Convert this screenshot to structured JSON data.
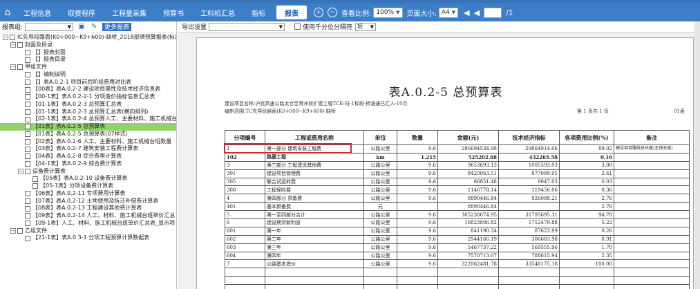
{
  "menu": {
    "home_icon": "house-icon",
    "tabs": [
      {
        "label": "工程信息"
      },
      {
        "label": "取费程序"
      },
      {
        "label": "工程量采集"
      },
      {
        "label": "预算书"
      },
      {
        "label": "工料机汇总"
      },
      {
        "label": "指标"
      },
      {
        "label": "报表"
      }
    ],
    "zoom_label": "查看比例:",
    "zoom_value": "100%",
    "pagesize_label": "页面大小:",
    "pagesize_value": "A4",
    "page_prev": "◀",
    "page_first": "◀",
    "page_next": "▶",
    "page_total": "/1"
  },
  "left": {
    "group_label": "报表组:",
    "more_btn": "更多报表",
    "tree": [
      {
        "level": 0,
        "tg": "⊟",
        "text": "IC先导段路面(K0+000~K9+600)-缺桥_2018部颁预算报表(标准"
      },
      {
        "level": 1,
        "tg": "⊟",
        "text": "封面及目录"
      },
      {
        "level": 2,
        "tg": "",
        "text": "【】报表封面"
      },
      {
        "level": 2,
        "tg": "",
        "text": "【】报表目录"
      },
      {
        "level": 1,
        "tg": "⊟",
        "text": "甲组文件"
      },
      {
        "level": 2,
        "tg": "",
        "text": "【】编制说明"
      },
      {
        "level": 2,
        "tg": "",
        "text": "【】表A.0.2-1 项目前后阶段费用对比表"
      },
      {
        "level": 2,
        "tg": "",
        "text": "【00表】表A.0.2-2 建设项目属性及技术经济信息表"
      },
      {
        "level": 2,
        "tg": "",
        "text": "【00-1表】表A.0.2-2-1 分项造价指标信息汇总表"
      },
      {
        "level": 2,
        "tg": "",
        "text": "【01-1表】表A.0.2-3 总预算汇总表"
      },
      {
        "level": 2,
        "tg": "",
        "text": "【01-1表】表A.0.2-3 总预算汇总表(横向排列)"
      },
      {
        "level": 2,
        "tg": "",
        "text": "【02-1表】表A.0.2-4 总预算人工、主要材料、施工机械台"
      },
      {
        "level": 2,
        "tg": "",
        "text": "【01表】表A.0.2-5 总预算表",
        "selected": true
      },
      {
        "level": 2,
        "tg": "",
        "text": "【01表】表A.0.2-5 总预算表(07样式)"
      },
      {
        "level": 2,
        "tg": "",
        "text": "【02表】表A.0.2-6 人工、主要材料、施工机械台班数量"
      },
      {
        "level": 2,
        "tg": "",
        "text": "【03表】表A.0.2-7 建筑安装工程费计算表"
      },
      {
        "level": 2,
        "tg": "",
        "text": "【04表】表A.0.2-8 综合费率计算表"
      },
      {
        "level": 2,
        "tg": "",
        "text": "【04-1表】表A.0.2-9 综合费计算表"
      },
      {
        "level": 2,
        "tg": "⊟",
        "text": "设备费计算表"
      },
      {
        "level": 3,
        "tg": "",
        "text": "【05表】表A.0.2-10 设备费计算表"
      },
      {
        "level": 3,
        "tg": "",
        "text": "【05-1表】分项设备费计算表"
      },
      {
        "level": 2,
        "tg": "",
        "text": "【06表】表A.0.2-11 专项费用计算表"
      },
      {
        "level": 2,
        "tg": "",
        "text": "【07表】表A.0.2-12 土地使用及拆迁补偿费计算表"
      },
      {
        "level": 2,
        "tg": "",
        "text": "【08表】表A.0.2-13 工程建设其他费计算表"
      },
      {
        "level": 2,
        "tg": "",
        "text": "【09表】表A.0.2-14 人工、材料、施工机械台班单价汇总"
      },
      {
        "level": 2,
        "tg": "",
        "text": "【09-1表】人工、材料、施工机械台班单价汇总表_显示项"
      },
      {
        "level": 1,
        "tg": "⊟",
        "text": "乙组文件"
      },
      {
        "level": 2,
        "tg": "",
        "text": "【21-1表】表A.0.3-1 分项工程预算计算数据表"
      }
    ]
  },
  "right": {
    "export_label": "导出设置",
    "thousands_label": "使用千分位分隔符",
    "sel2_value": "项"
  },
  "report": {
    "title": "表A.0.2-5 总预算表",
    "project_line": "建设项目名称:沪武高速公路太仓至常州段扩建工程TCK-SJ-1标段-桥涵通已汇入-10月",
    "scope_line": "编制范围:TC先导段路面(K0+000~K9+600)-缺桥",
    "page_info": "第 1 页共 1 页",
    "form_no": "01表",
    "headers": [
      "分项编号",
      "工程或费用名称",
      "单位",
      "数量",
      "金额(元)",
      "技术经济指标",
      "各项费用比例(%)",
      "备注"
    ],
    "rows": [
      [
        "1",
        "第一部分 建筑安装工程费",
        "公路公里",
        "9.6",
        "286694534.98",
        "29864014.06",
        "89.02",
        "建设项目路线总长度(主线长度)"
      ],
      [
        "102",
        "路基工程",
        "km",
        "1.215",
        "525202.68",
        "432265.58",
        "0.16",
        ""
      ],
      [
        "3",
        "第三部分 工程建设其他费",
        "公路公里",
        "9.6",
        "9653693.13",
        "1005593.03",
        "3.00",
        ""
      ],
      [
        "301",
        "建设项目管理费",
        "公路公里",
        "9.6",
        "8420063.51",
        "877089.95",
        "2.61",
        ""
      ],
      [
        "305",
        "联合试运转费",
        "公路公里",
        "9.6",
        "86851.48",
        "9047.03",
        "0.03",
        ""
      ],
      [
        "308",
        "工程保险费",
        "公路公里",
        "9.6",
        "1146778.14",
        "119456.06",
        "0.36",
        ""
      ],
      [
        "4",
        "第四部分 预备费",
        "公路公里",
        "9.6",
        "8890446.84",
        "926088.21",
        "2.76",
        ""
      ],
      [
        "401",
        "基本预备费",
        "元",
        "",
        "8890446.84",
        "",
        "2.76",
        ""
      ],
      [
        "5",
        "第一至四部分合计",
        "公路公里",
        "9.6",
        "305238674.95",
        "31795695.31",
        "94.78",
        ""
      ],
      [
        "6",
        "建设期贷款利息",
        "公路公里",
        "9.6",
        "16823806.82",
        "1752479.88",
        "5.22",
        ""
      ],
      [
        "601",
        "第一年",
        "公路公里",
        "9.6",
        "841190.34",
        "87623.99",
        "0.26",
        ""
      ],
      [
        "602",
        "第二年",
        "公路公里",
        "9.6",
        "2944166.19",
        "306683.98",
        "0.91",
        ""
      ],
      [
        "603",
        "第三年",
        "公路公里",
        "9.6",
        "5467737.22",
        "569555.96",
        "1.70",
        ""
      ],
      [
        "604",
        "第四年",
        "公路公里",
        "9.6",
        "7570713.07",
        "788615.94",
        "2.35",
        ""
      ],
      [
        "7",
        "公路基本造价",
        "公路公里",
        "9.6",
        "322062481.78",
        "33548175.18",
        "100.00",
        ""
      ],
      [
        "",
        "",
        "",
        "",
        "",
        "",
        "",
        ""
      ],
      [
        "",
        "",
        "",
        "",
        "",
        "",
        "",
        ""
      ],
      [
        "",
        "",
        "",
        "",
        "",
        "",
        "",
        ""
      ]
    ]
  }
}
